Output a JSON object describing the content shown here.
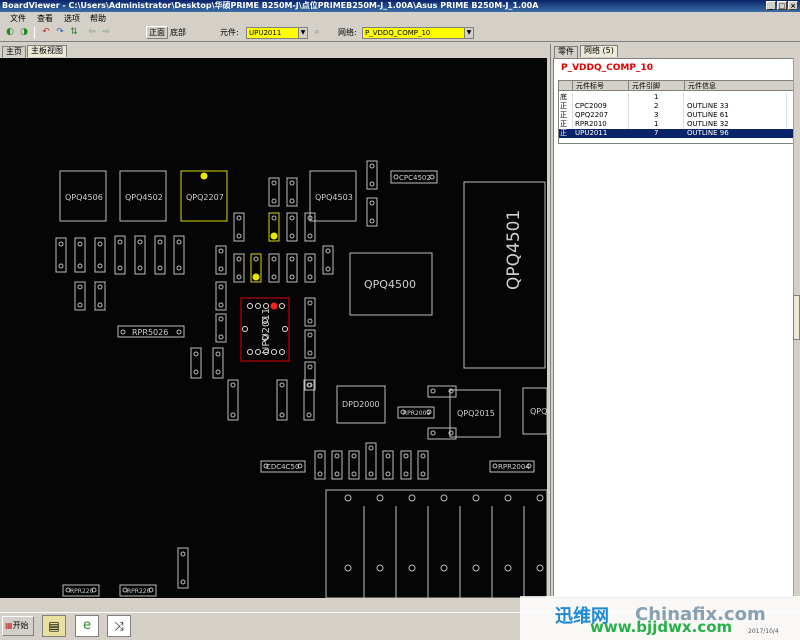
{
  "window": {
    "title": "BoardViewer  -  C:\\Users\\Administrator\\Desktop\\华硕PRIME B250M-J\\点位PRIMEB250M-J_1.00A\\Asus PRIME B250M-J_1.00A",
    "buttons": [
      "_",
      "□",
      "×"
    ]
  },
  "menu": [
    "文件",
    "查看",
    "选项",
    "帮助"
  ],
  "toolbar": {
    "front_label": "正面",
    "bottom_label": "底部",
    "component_label": "元件:",
    "component_value": "UPU2011",
    "net_label": "网络:",
    "net_value": "P_VDDQ_COMP_10"
  },
  "tabs": {
    "left": [
      "主页",
      "主板视图"
    ],
    "right": [
      "零件",
      "网络 (5)"
    ]
  },
  "net_panel": {
    "net_name": "P_VDDQ_COMP_10",
    "columns": [
      "元件标号",
      "元件引脚",
      "元件信息"
    ],
    "rows": [
      {
        "side": "底",
        "ref": "",
        "pin": "1",
        "info": ""
      },
      {
        "side": "正",
        "ref": "CPC2009",
        "pin": "2",
        "info": "OUTLINE  33"
      },
      {
        "side": "正",
        "ref": "QPQ2207",
        "pin": "3",
        "info": "OUTLINE  61"
      },
      {
        "side": "正",
        "ref": "RPR2010",
        "pin": "1",
        "info": "OUTLINE  32"
      },
      {
        "side": "正",
        "ref": "UPU2011",
        "pin": "7",
        "info": "OUTLINE  96"
      }
    ]
  },
  "board_labels": {
    "qpq4506": "QPQ4506",
    "qpq4502": "QPQ4502",
    "qpq2207": "QPQ2207",
    "qpq4503": "QPQ4503",
    "cpc4502": "CPC4502",
    "qpq4501": "QPQ4501",
    "qpq4500": "QPQ4500",
    "rpr5026": "RPR5026",
    "upu2011": "UPU2011",
    "dpd2000": "DPD2000",
    "rpr2009": "RPR2009",
    "qpq2015": "QPQ2015",
    "cdc4c50": "CDC4C50",
    "rpr2004": "RPR2004",
    "rpr220": "RPR220",
    "rpr220b": "RPR220",
    "qpq_edge": "QPQ"
  },
  "taskbar": {
    "start_label": "开始"
  },
  "watermark": {
    "cn": "迅维网",
    "en": "Chinafix.com",
    "url": "www.bjjdwx.com",
    "date": "2017/10/4"
  },
  "colors": {
    "highlight_net": "#ffff00",
    "selected_part": "#e00000",
    "board_bg": "#050505",
    "outline": "#bdbdbd"
  }
}
